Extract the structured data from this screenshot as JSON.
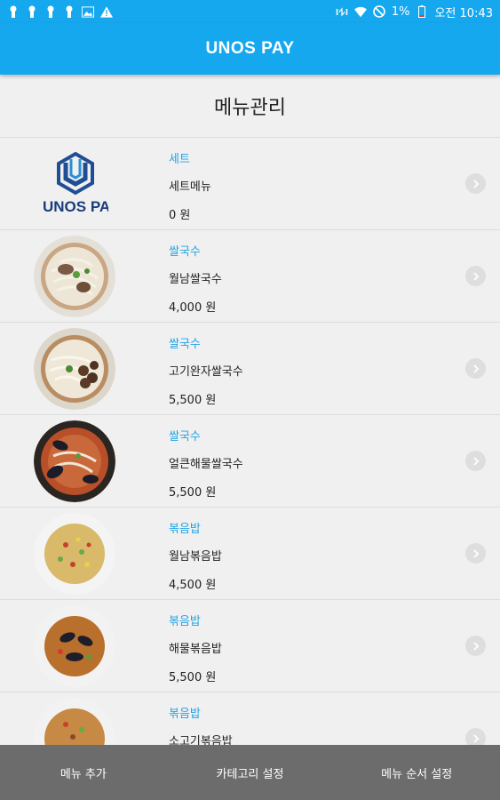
{
  "status_bar": {
    "battery_percent": "1%",
    "time": "오전 10:43"
  },
  "app_bar": {
    "title": "UNOS PAY"
  },
  "page": {
    "title": "메뉴관리"
  },
  "logo": {
    "text": "UNOS PAY"
  },
  "menu_items": [
    {
      "category": "세트",
      "name": "세트메뉴",
      "price": "0 원"
    },
    {
      "category": "쌀국수",
      "name": "월남쌀국수",
      "price": "4,000 원"
    },
    {
      "category": "쌀국수",
      "name": "고기완자쌀국수",
      "price": "5,500 원"
    },
    {
      "category": "쌀국수",
      "name": "얼큰해물쌀국수",
      "price": "5,500 원"
    },
    {
      "category": "볶음밥",
      "name": "월남볶음밥",
      "price": "4,500 원"
    },
    {
      "category": "볶음밥",
      "name": "해물볶음밥",
      "price": "5,500 원"
    },
    {
      "category": "볶음밥",
      "name": "소고기볶음밥",
      "price": ""
    }
  ],
  "bottom_bar": {
    "add_menu": "메뉴 추가",
    "category_settings": "카테고리 설정",
    "order_settings": "메뉴 순서 설정"
  },
  "colors": {
    "primary": "#16a8ef",
    "category_text": "#22a5e6",
    "bottom_bar": "#6c6c6c"
  }
}
